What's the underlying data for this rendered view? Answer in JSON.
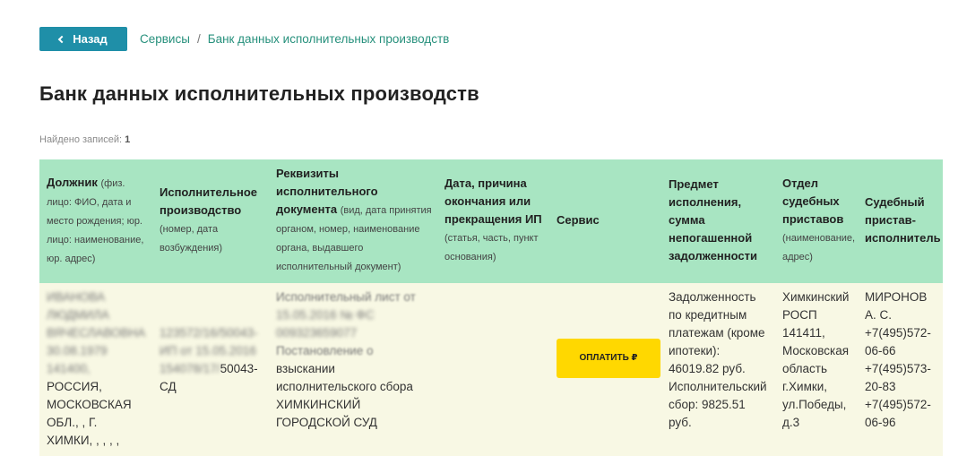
{
  "nav": {
    "back_label": "Назад",
    "breadcrumb": [
      "Сервисы",
      "Банк данных исполнительных производств"
    ]
  },
  "page": {
    "title": "Банк данных исполнительных производств",
    "found_label": "Найдено записей:",
    "found_count": "1"
  },
  "table": {
    "headers": [
      {
        "title": "Должник",
        "sub": "(физ. лицо: ФИО, дата и место рождения; юр. лицо: наименование, юр. адрес)"
      },
      {
        "title": "Исполнительное производство",
        "sub": "(номер, дата возбуждения)"
      },
      {
        "title": "Реквизиты исполнительного документа",
        "sub": "(вид, дата принятия органом, номер, наименование органа, выдавшего исполнительный документ)"
      },
      {
        "title": "Дата, причина окончания или прекращения ИП",
        "sub": "(статья, часть, пункт основания)"
      },
      {
        "title": "Сервис",
        "sub": ""
      },
      {
        "title": "Предмет исполнения, сумма непогашенной задолженности",
        "sub": ""
      },
      {
        "title": "Отдел судебных приставов",
        "sub": "(наименование, адрес)"
      },
      {
        "title": "Судебный пристав-исполнитель",
        "sub": ""
      }
    ],
    "row": {
      "debtor_blurred": [
        "ИВАНОВА",
        "ЛЮДМИЛА",
        "ВЯЧЕСЛАВОВНА",
        "30.08.1979",
        "141400,"
      ],
      "debtor_rest": [
        "РОССИЯ,",
        "МОСКОВСКАЯ",
        "ОБЛ., , Г.",
        "ХИМКИ, , , , ,"
      ],
      "proceeding_blurred": [
        "123572/16/50043-",
        "ИП от 15.05.2016",
        "154078/17/"
      ],
      "proceeding_rest": [
        "50043-",
        "СД"
      ],
      "document_blurred": [
        "Исполнительный лист от",
        "15.05.2016 № ФС",
        "009323659077",
        "Постановление о"
      ],
      "document_rest": [
        "взыскании",
        "исполнительского сбора",
        "ХИМКИНСКИЙ",
        "ГОРОДСКОЙ СУД"
      ],
      "end_reason": "",
      "pay_label": "ОПЛАТИТЬ ₽",
      "subject_lines": [
        "Задолженность",
        "по кредитным",
        "платежам (кроме",
        "ипотеки):",
        "46019.82 руб.",
        "Исполнительский",
        "сбор: 9825.51",
        "руб."
      ],
      "department_lines": [
        "Химкинский",
        "РОСП",
        "141411,",
        "Московская",
        "область",
        "г.Химки,",
        "ул.Победы,",
        "д.3"
      ],
      "bailiff_lines": [
        "МИРОНОВ",
        "А. С.",
        "+7(495)572-",
        "06-66",
        "+7(495)573-",
        "20-83",
        "+7(495)572-",
        "06-96"
      ]
    }
  }
}
